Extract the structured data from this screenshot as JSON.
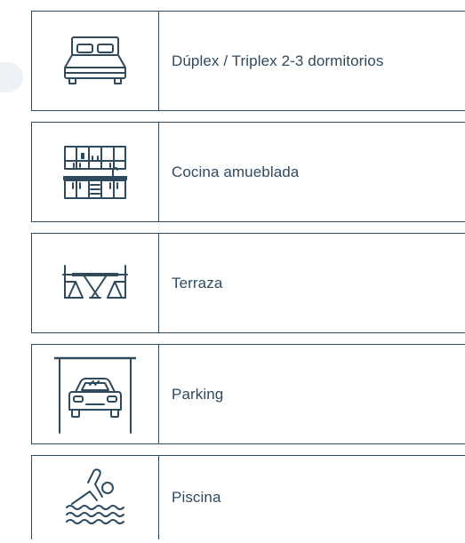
{
  "features": [
    {
      "label": "Dúplex / Triplex 2-3 dormitorios",
      "icon": "bed-icon"
    },
    {
      "label": "Cocina amueblada",
      "icon": "kitchen-icon"
    },
    {
      "label": "Terraza",
      "icon": "terrace-table-icon"
    },
    {
      "label": "Parking",
      "icon": "parking-car-icon"
    },
    {
      "label": "Piscina",
      "icon": "swimmer-pool-icon"
    }
  ],
  "colors": {
    "border": "#2f4a5c",
    "text": "#2f4a5c",
    "background": "#ffffff"
  }
}
